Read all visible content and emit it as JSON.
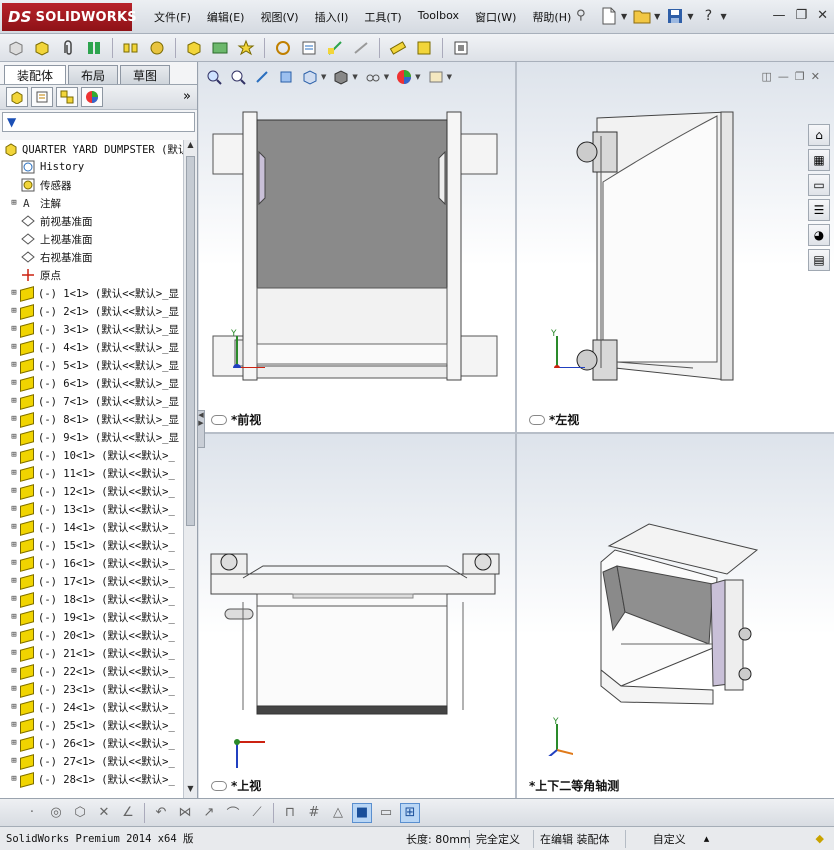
{
  "app": {
    "brand": "SOLIDWORKS",
    "brand_prefix": "DS"
  },
  "menu": [
    "文件(F)",
    "编辑(E)",
    "视图(V)",
    "插入(I)",
    "工具(T)",
    "Toolbox",
    "窗口(W)",
    "帮助(H)"
  ],
  "feature_manager": {
    "tabs": [
      "装配体",
      "布局",
      "草图"
    ],
    "root": "QUARTER YARD DUMPSTER (默认<显",
    "fixed_nodes": [
      {
        "label": "History",
        "icon": "history-icon"
      },
      {
        "label": "传感器",
        "icon": "sensor-icon"
      },
      {
        "label": "注解",
        "icon": "annotation-icon"
      },
      {
        "label": "前视基准面",
        "icon": "plane-icon"
      },
      {
        "label": "上视基准面",
        "icon": "plane-icon"
      },
      {
        "label": "右视基准面",
        "icon": "plane-icon"
      },
      {
        "label": "原点",
        "icon": "origin-icon"
      }
    ],
    "parts": [
      "(-) 1<1> (默认<<默认>_显",
      "(-) 2<1> (默认<<默认>_显",
      "(-) 3<1> (默认<<默认>_显",
      "(-) 4<1> (默认<<默认>_显",
      "(-) 5<1> (默认<<默认>_显",
      "(-) 6<1> (默认<<默认>_显",
      "(-) 7<1> (默认<<默认>_显",
      "(-) 8<1> (默认<<默认>_显",
      "(-) 9<1> (默认<<默认>_显",
      "(-) 10<1> (默认<<默认>_",
      "(-) 11<1> (默认<<默认>_",
      "(-) 12<1> (默认<<默认>_",
      "(-) 13<1> (默认<<默认>_",
      "(-) 14<1> (默认<<默认>_",
      "(-) 15<1> (默认<<默认>_",
      "(-) 16<1> (默认<<默认>_",
      "(-) 17<1> (默认<<默认>_",
      "(-) 18<1> (默认<<默认>_",
      "(-) 19<1> (默认<<默认>_",
      "(-) 20<1> (默认<<默认>_",
      "(-) 21<1> (默认<<默认>_",
      "(-) 22<1> (默认<<默认>_",
      "(-) 23<1> (默认<<默认>_",
      "(-) 24<1> (默认<<默认>_",
      "(-) 25<1> (默认<<默认>_",
      "(-) 26<1> (默认<<默认>_",
      "(-) 27<1> (默认<<默认>_",
      "(-) 28<1> (默认<<默认>_"
    ]
  },
  "viewports": {
    "front": "*前视",
    "left": "*左视",
    "top": "*上视",
    "iso": "*上下二等角轴测"
  },
  "axes": {
    "x": "X",
    "y": "Y",
    "z": "Z"
  },
  "status": {
    "version": "SolidWorks Premium 2014 x64 版",
    "length": "长度: 80mm",
    "defined": "完全定义",
    "mode": "在编辑 装配体",
    "units": "自定义",
    "units_caret": "▴"
  },
  "colors": {
    "accent_red": "#b8232b",
    "panel_fill": "#8a8a8a",
    "side_fill": "#c9c0d8"
  }
}
